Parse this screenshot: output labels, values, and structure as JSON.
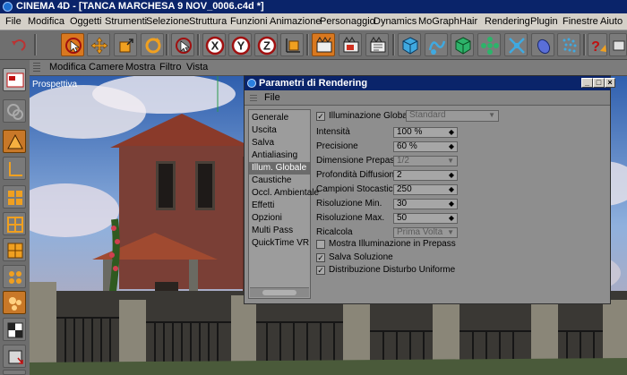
{
  "window": {
    "title": "CINEMA 4D - [TANCA MARCHESA 9 NOV_0006.c4d *]"
  },
  "menubar": [
    "File",
    "Modifica",
    "Oggetti",
    "Strumenti",
    "Selezione",
    "Struttura",
    "Funzioni",
    "Animazione",
    "Personaggio",
    "Dynamics",
    "MoGraph",
    "Hair",
    "Rendering",
    "Plugin",
    "Finestre",
    "Aiuto"
  ],
  "toolbar": {
    "icons": [
      "undo-icon",
      "select-live-icon",
      "move-icon",
      "scale-icon",
      "rotate-icon",
      "recent-tool-icon",
      "x-axis-icon",
      "y-axis-icon",
      "z-axis-icon",
      "coordinate-system-icon",
      "render-view-icon",
      "render-picture-viewer-icon",
      "render-settings-icon",
      "cube-primitive-icon",
      "spline-icon",
      "nurbs-icon",
      "array-icon",
      "deformer-icon",
      "scene-icon",
      "light-icon",
      "help-icon",
      "extra-icon"
    ],
    "axis_labels": [
      "X",
      "Y",
      "Z"
    ],
    "help_label": "?"
  },
  "viewport": {
    "menu": [
      "Modifica",
      "Camere",
      "Mostra",
      "Filtro",
      "Vista"
    ],
    "label": "Prospettiva"
  },
  "left_palette": [
    "layout-icon",
    "model-tool-icon",
    "object-tool-icon",
    "point-tool-icon",
    "edge-tool-icon",
    "polygon-tool-icon",
    "texture-tool-icon",
    "axis-tool-icon",
    "tweak-tool-icon",
    "workplane-icon",
    "animation-icon",
    "snap-icon"
  ],
  "dialog": {
    "title": "Parametri di Rendering",
    "menu_file": "File",
    "window_buttons": [
      "_",
      "□",
      "×"
    ],
    "categories": [
      "Generale",
      "Uscita",
      "Salva",
      "Antialiasing",
      "Illum. Globale",
      "Caustiche",
      "Occl. Ambientale",
      "Effetti",
      "Opzioni",
      "Multi Pass",
      "QuickTime VR"
    ],
    "selected_category": "Illum. Globale",
    "gi_enabled_label": "Illuminazione Globale",
    "gi_mode": "Standard",
    "params": [
      {
        "label": "Intensità",
        "value": "100 %"
      },
      {
        "label": "Precisione",
        "value": "60 %"
      },
      {
        "label": "Dimensione Prepass",
        "value": "1/2",
        "disabled": true
      },
      {
        "label": "Profondità Diffusione",
        "value": "2"
      },
      {
        "label": "Campioni Stocastici",
        "value": "250"
      },
      {
        "label": "Risoluzione Min.",
        "value": "30"
      },
      {
        "label": "Risoluzione Max.",
        "value": "50"
      },
      {
        "label": "Ricalcola",
        "value": "Prima Volta",
        "disabled": true
      }
    ],
    "checkboxes": [
      {
        "label": "Mostra Illuminazione in Prepass",
        "checked": false
      },
      {
        "label": "Salva Soluzione",
        "checked": true
      },
      {
        "label": "Distribuzione Disturbo Uniforme",
        "checked": true
      }
    ]
  }
}
